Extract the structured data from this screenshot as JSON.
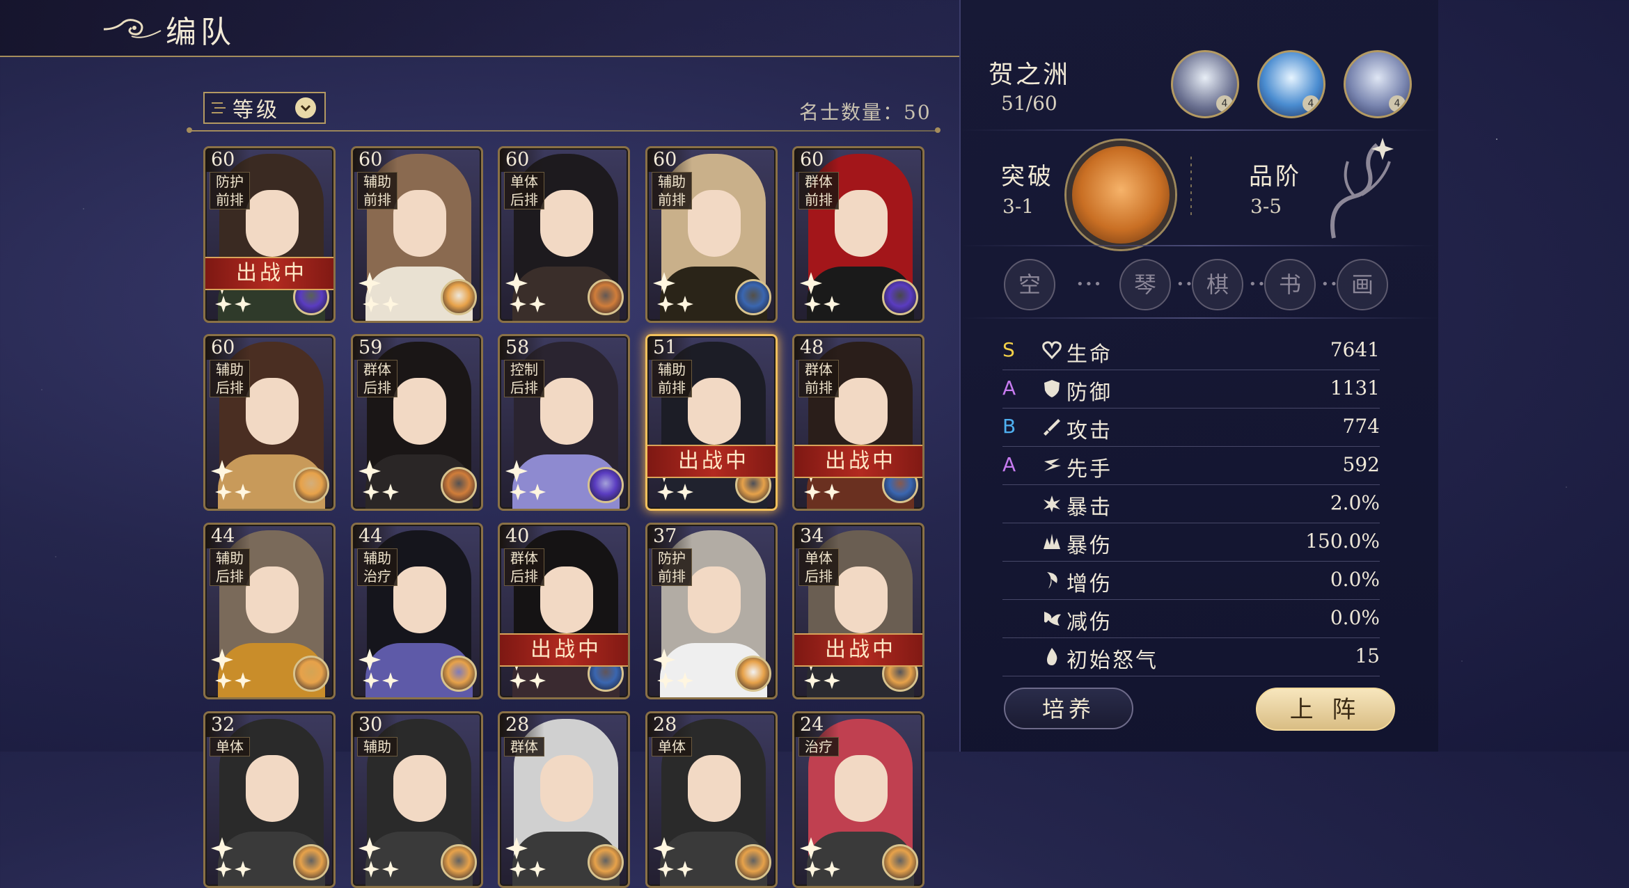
{
  "header": {
    "title": "编队"
  },
  "sort": {
    "label": "等级",
    "count_text": "名士数量：50"
  },
  "cards": [
    {
      "level": "60",
      "role1": "防护",
      "role2": "前排",
      "deployed": true,
      "palette": "#3a2a22",
      "body": "#2f3a2a",
      "badge": "#5a3cc0"
    },
    {
      "level": "60",
      "role1": "辅助",
      "role2": "前排",
      "deployed": false,
      "palette": "#8a6a50",
      "body": "#e9e1d2",
      "badge": "#e7a24a"
    },
    {
      "level": "60",
      "role1": "单体",
      "role2": "后排",
      "deployed": false,
      "palette": "#1d1a1e",
      "body": "#3a2e2a",
      "badge": "#d07d3a"
    },
    {
      "level": "60",
      "role1": "辅助",
      "role2": "前排",
      "deployed": false,
      "palette": "#c9b08a",
      "body": "#2a2418",
      "badge": "#3a66b0"
    },
    {
      "level": "60",
      "role1": "群体",
      "role2": "前排",
      "deployed": false,
      "palette": "#a3161a",
      "body": "#1a1a1a",
      "badge": "#5a3cc0"
    },
    {
      "level": "60",
      "role1": "辅助",
      "role2": "后排",
      "deployed": false,
      "palette": "#4a2e22",
      "body": "#c89a5a",
      "badge": "#e7a24a"
    },
    {
      "level": "59",
      "role1": "群体",
      "role2": "后排",
      "deployed": false,
      "palette": "#1a1616",
      "body": "#2a2626",
      "badge": "#d07d3a"
    },
    {
      "level": "58",
      "role1": "控制",
      "role2": "后排",
      "deployed": false,
      "palette": "#2a2430",
      "body": "#8e8ad0",
      "badge": "#5a3cc0"
    },
    {
      "level": "51",
      "role1": "辅助",
      "role2": "前排",
      "deployed": true,
      "palette": "#1c1d26",
      "body": "#20222e",
      "badge": "#e7a24a",
      "selected": true
    },
    {
      "level": "48",
      "role1": "群体",
      "role2": "前排",
      "deployed": true,
      "palette": "#2a1e1a",
      "body": "#6a3020",
      "badge": "#3a66b0"
    },
    {
      "level": "44",
      "role1": "辅助",
      "role2": "后排",
      "deployed": false,
      "palette": "#7a6a5a",
      "body": "#c98d2a",
      "badge": "#e7a24a"
    },
    {
      "level": "44",
      "role1": "辅助",
      "role2": "治疗",
      "deployed": false,
      "palette": "#15151c",
      "body": "#5e5aa8",
      "badge": "#e7a24a"
    },
    {
      "level": "40",
      "role1": "群体",
      "role2": "后排",
      "deployed": true,
      "palette": "#151314",
      "body": "#3a2a30",
      "badge": "#3a66b0"
    },
    {
      "level": "37",
      "role1": "防护",
      "role2": "前排",
      "deployed": false,
      "palette": "#b2aca4",
      "body": "#efefef",
      "badge": "#e7a24a"
    },
    {
      "level": "34",
      "role1": "单体",
      "role2": "后排",
      "deployed": true,
      "palette": "#6a5e52",
      "body": "#2a2a30",
      "badge": "#e7a24a"
    },
    {
      "level": "32",
      "role1": "单体",
      "role2": "",
      "deployed": false,
      "palette": "#2a2a2a",
      "body": "#3a3a3a",
      "badge": "#e7a24a"
    },
    {
      "level": "30",
      "role1": "辅助",
      "role2": "",
      "deployed": false,
      "palette": "#2a2a2a",
      "body": "#3a3a3a",
      "badge": "#e7a24a"
    },
    {
      "level": "28",
      "role1": "群体",
      "role2": "",
      "deployed": false,
      "palette": "#d0d0d0",
      "body": "#3a3a3a",
      "badge": "#e7a24a"
    },
    {
      "level": "28",
      "role1": "单体",
      "role2": "",
      "deployed": false,
      "palette": "#2a2a2a",
      "body": "#3a3a3a",
      "badge": "#e7a24a"
    },
    {
      "level": "24",
      "role1": "治疗",
      "role2": "",
      "deployed": false,
      "palette": "#c04050",
      "body": "#3a3a3a",
      "badge": "#e7a24a"
    }
  ],
  "deployed_label": "出战中",
  "hero": {
    "name": "贺之洲",
    "level": "51/60",
    "skills": [
      "4",
      "4",
      "4"
    ],
    "breakthrough_label": "突破",
    "breakthrough_value": "3-1",
    "rank_label": "品阶",
    "rank_value": "3-5",
    "talents": [
      "空",
      "琴",
      "棋",
      "书",
      "画"
    ]
  },
  "stats": [
    {
      "grade": "S",
      "grade_color": "#f2d048",
      "icon": "heart-icon",
      "name": "生命",
      "value": "7641"
    },
    {
      "grade": "A",
      "grade_color": "#c77bf0",
      "icon": "shield-icon",
      "name": "防御",
      "value": "1131"
    },
    {
      "grade": "B",
      "grade_color": "#4fb0f0",
      "icon": "sword-icon",
      "name": "攻击",
      "value": "774"
    },
    {
      "grade": "A",
      "grade_color": "#c77bf0",
      "icon": "speed-icon",
      "name": "先手",
      "value": "592"
    },
    {
      "grade": "",
      "grade_color": "",
      "icon": "crit-icon",
      "name": "暴击",
      "value": "2.0%"
    },
    {
      "grade": "",
      "grade_color": "",
      "icon": "crit-damage-icon",
      "name": "暴伤",
      "value": "150.0%"
    },
    {
      "grade": "",
      "grade_color": "",
      "icon": "damage-up-icon",
      "name": "增伤",
      "value": "0.0%"
    },
    {
      "grade": "",
      "grade_color": "",
      "icon": "damage-reduce-icon",
      "name": "减伤",
      "value": "0.0%"
    },
    {
      "grade": "",
      "grade_color": "",
      "icon": "rage-icon",
      "name": "初始怒气",
      "value": "15"
    }
  ],
  "buttons": {
    "train": "培养",
    "deploy": "上 阵"
  }
}
